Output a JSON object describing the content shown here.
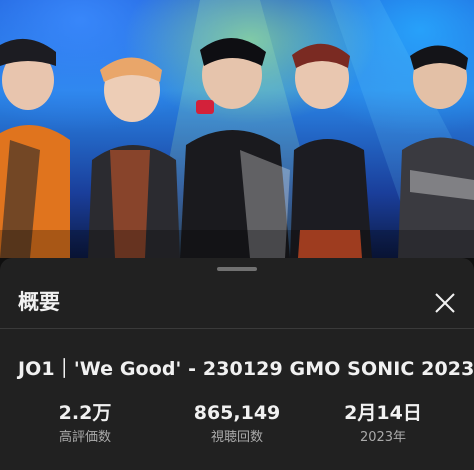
{
  "video": {
    "description_icon": "concert-video-thumbnail"
  },
  "sheet": {
    "title": "概要",
    "close_icon": "close-icon"
  },
  "details": {
    "video_title": "JO1｜'We Good' - 230129  GMO SONIC 2023"
  },
  "stats": [
    {
      "value": "2.2万",
      "label": "高評価数"
    },
    {
      "value": "865,149",
      "label": "視聴回数"
    },
    {
      "value": "2月14日",
      "label": "2023年"
    }
  ],
  "colors": {
    "background": "#0f0f0f",
    "sheet": "#212121",
    "text_primary": "#f1f1f1",
    "text_secondary": "#aaaaaa"
  }
}
